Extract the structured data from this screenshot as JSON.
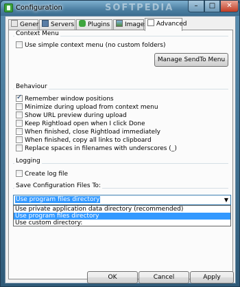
{
  "window": {
    "title": "Configuration",
    "watermark": "SOFTPEDIA"
  },
  "tabs": [
    {
      "label": "General"
    },
    {
      "label": "Servers"
    },
    {
      "label": "Plugins"
    },
    {
      "label": "Images"
    },
    {
      "label": "Advanced"
    }
  ],
  "context_menu": {
    "heading": "Context Menu",
    "simple_label": "Use simple context menu (no custom folders)",
    "simple_checked": false,
    "manage_button": "Manage SendTo Menu"
  },
  "behaviour": {
    "heading": "Behaviour",
    "options": [
      {
        "label": "Remember window positions",
        "checked": true
      },
      {
        "label": "Minimize during upload from context menu",
        "checked": false
      },
      {
        "label": "Show URL preview during upload",
        "checked": false
      },
      {
        "label": "Keep Rightload open when I click Done",
        "checked": false
      },
      {
        "label": "When finished, close Rightload immediately",
        "checked": false
      },
      {
        "label": "When finished, copy all links to clipboard",
        "checked": false
      },
      {
        "label": "Replace spaces in filenames with underscores (_)",
        "checked": false
      }
    ]
  },
  "logging": {
    "heading": "Logging",
    "create_log_label": "Create log file",
    "create_log_checked": false
  },
  "save_config": {
    "heading": "Save Configuration Files To:",
    "selected": "Use program files directory",
    "options": [
      "Use private application data directory (recommended)",
      "Use program files directory",
      "Use custom directory:"
    ],
    "highlighted_index": 1
  },
  "footer": {
    "ok": "OK",
    "cancel": "Cancel",
    "apply": "Apply"
  },
  "colors": {
    "accent": "#3399ff",
    "titlebar": "#4b7ea1",
    "close": "#c23c23"
  }
}
